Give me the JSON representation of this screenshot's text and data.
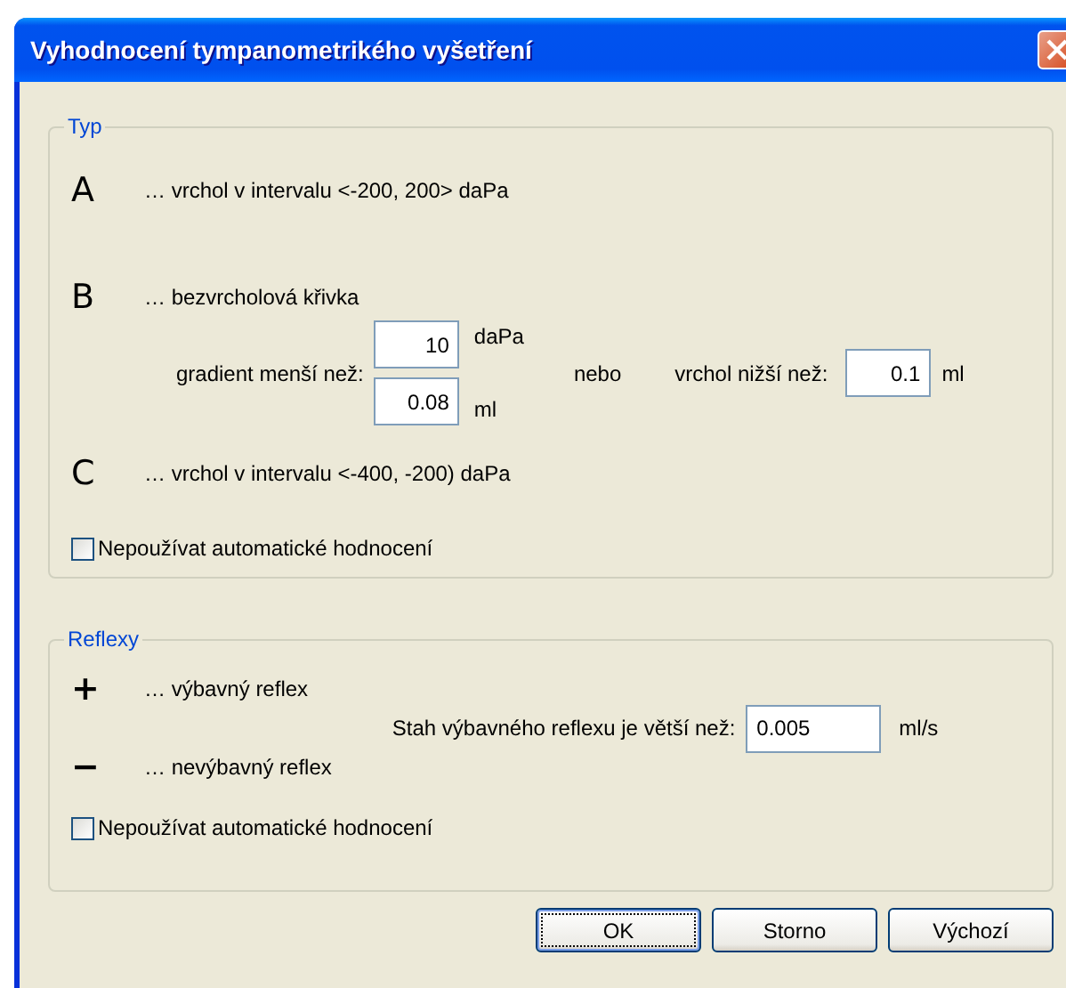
{
  "window": {
    "title": "Vyhodnocení tympanometrikého vyšetření"
  },
  "typ": {
    "title": "Typ",
    "types": [
      {
        "letter": "A",
        "description": "… vrchol v intervalu <-200, 200> daPa"
      },
      {
        "letter": "B",
        "description": "… bezvrcholová křivka"
      },
      {
        "letter": "C",
        "description": "… vrchol v intervalu <-400, -200) daPa"
      }
    ],
    "gradient": {
      "label": "gradient menší než:",
      "fields": [
        {
          "value": "10",
          "unit": "daPa"
        },
        {
          "value": "0.08",
          "unit": "ml"
        }
      ]
    },
    "or": "nebo",
    "peak": {
      "label": "vrchol nižší než:",
      "value": "0.1",
      "unit": "ml"
    },
    "manual": {
      "label": "Nepoužívat automatické hodnocení",
      "checked": false
    }
  },
  "reflexy": {
    "title": "Reflexy",
    "types": [
      {
        "symbol": "+",
        "description": "… výbavný reflex"
      },
      {
        "symbol": "−",
        "description": "… nevýbavný reflex"
      }
    ],
    "threshold": {
      "label": "Stah výbavného reflexu je větší než:",
      "value": "0.005",
      "unit": "ml/s"
    },
    "manual": {
      "label": "Nepoužívat automatické hodnocení",
      "checked": false
    }
  },
  "buttons": [
    {
      "label": "OK",
      "default": true
    },
    {
      "label": "Storno",
      "default": false
    },
    {
      "label": "Výchozí",
      "default": false
    }
  ]
}
